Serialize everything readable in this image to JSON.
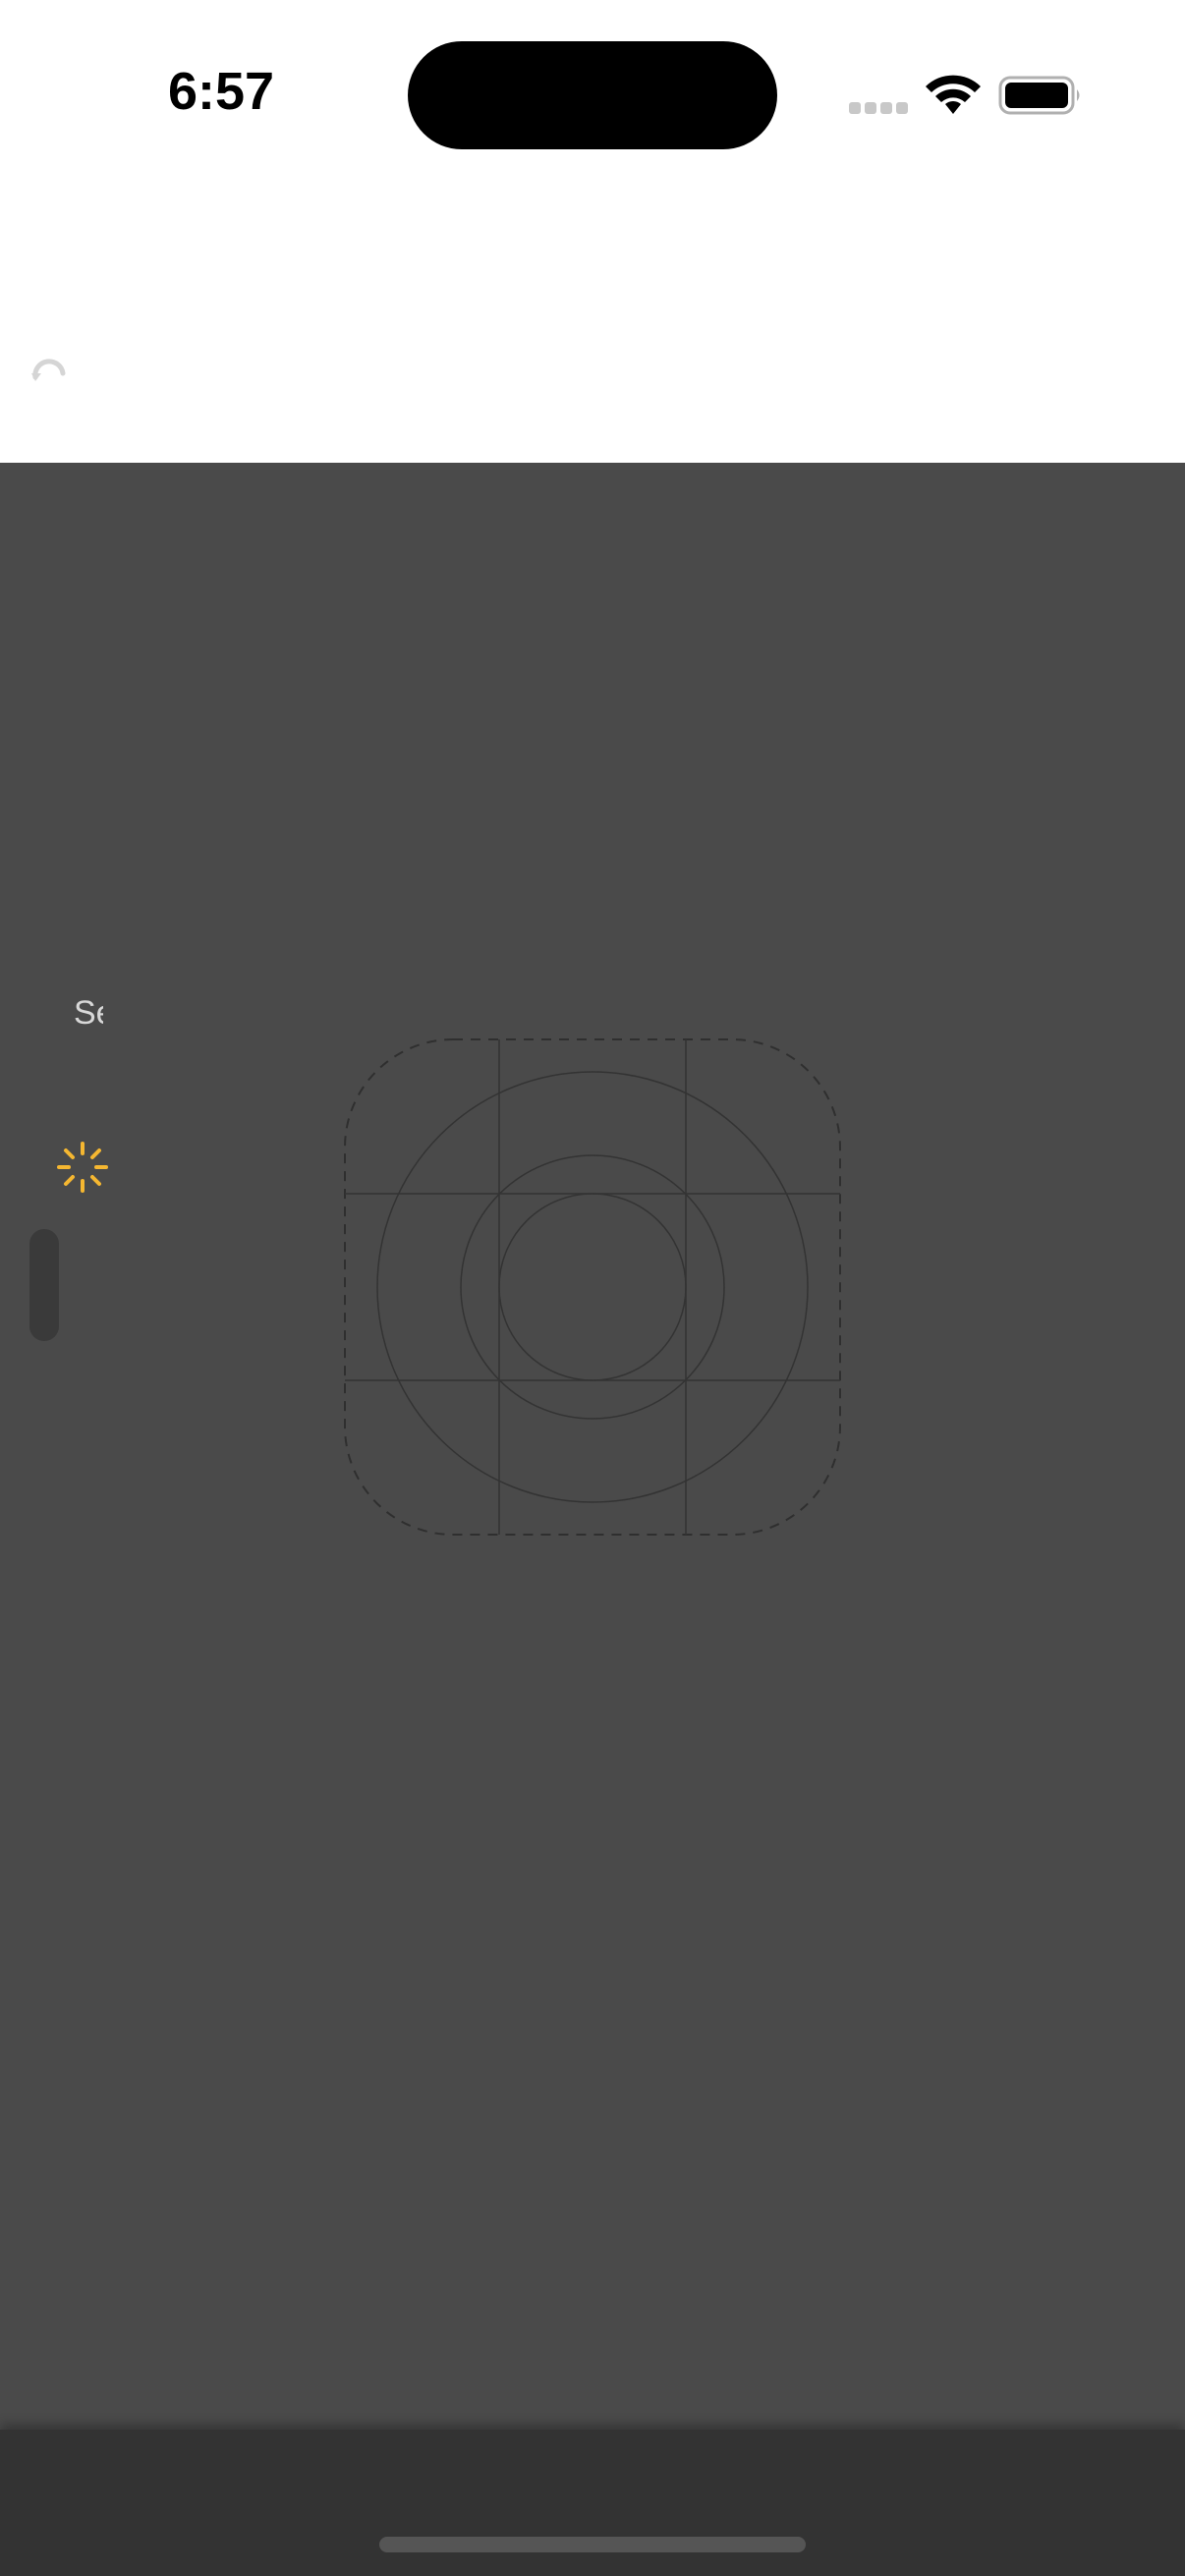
{
  "status_bar": {
    "time": "6:57",
    "icons": [
      "cellular-signal-icon",
      "wifi-icon",
      "battery-icon"
    ]
  },
  "top_area": {
    "icons": [
      "refresh-icon"
    ]
  },
  "canvas": {
    "side_label": "Se",
    "icons": [
      "loading-spinner-icon",
      "app-icon-template-grid-icon"
    ],
    "colors": {
      "background": "#4a4a4a",
      "spinner": "#f5b731",
      "template_lines": "#333333"
    }
  },
  "bottom_bar": {
    "colors": {
      "background": "#333333",
      "home_indicator": "#555555"
    }
  }
}
